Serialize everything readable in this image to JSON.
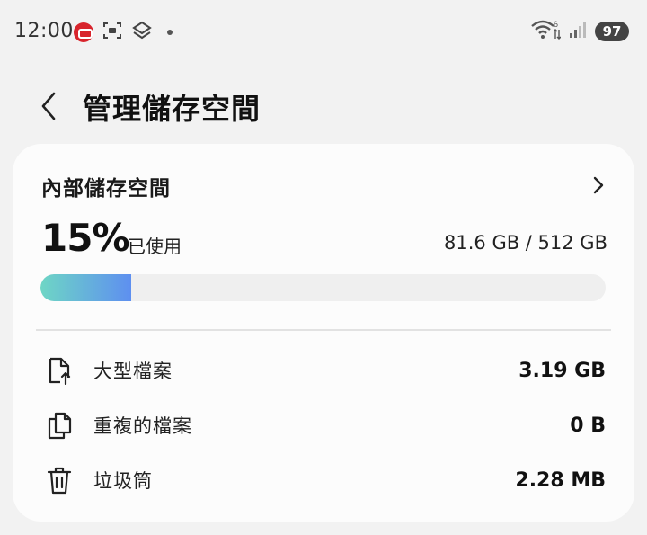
{
  "status_bar": {
    "time": "12:00",
    "battery": "97",
    "network_label": "6",
    "icons": [
      "app-notification-icon",
      "screenshot-icon",
      "layers-icon",
      "wifi-icon",
      "signal-icon"
    ]
  },
  "header": {
    "title": "管理儲存空間",
    "back_icon": "back-arrow-icon"
  },
  "storage": {
    "title": "內部儲存空間",
    "percent_text": "15%",
    "used_label": "已使用",
    "capacity_text": "81.6 GB / 512 GB",
    "used_fraction": 0.16,
    "bar_colors": {
      "start": "#6ed6c5",
      "end": "#5e8ff0",
      "track": "#efefef"
    }
  },
  "items": [
    {
      "label": "大型檔案",
      "value": "3.19 GB",
      "icon": "large-file-icon"
    },
    {
      "label": "重複的檔案",
      "value": "0 B",
      "icon": "duplicate-files-icon"
    },
    {
      "label": "垃圾筒",
      "value": "2.28 MB",
      "icon": "trash-icon"
    }
  ]
}
